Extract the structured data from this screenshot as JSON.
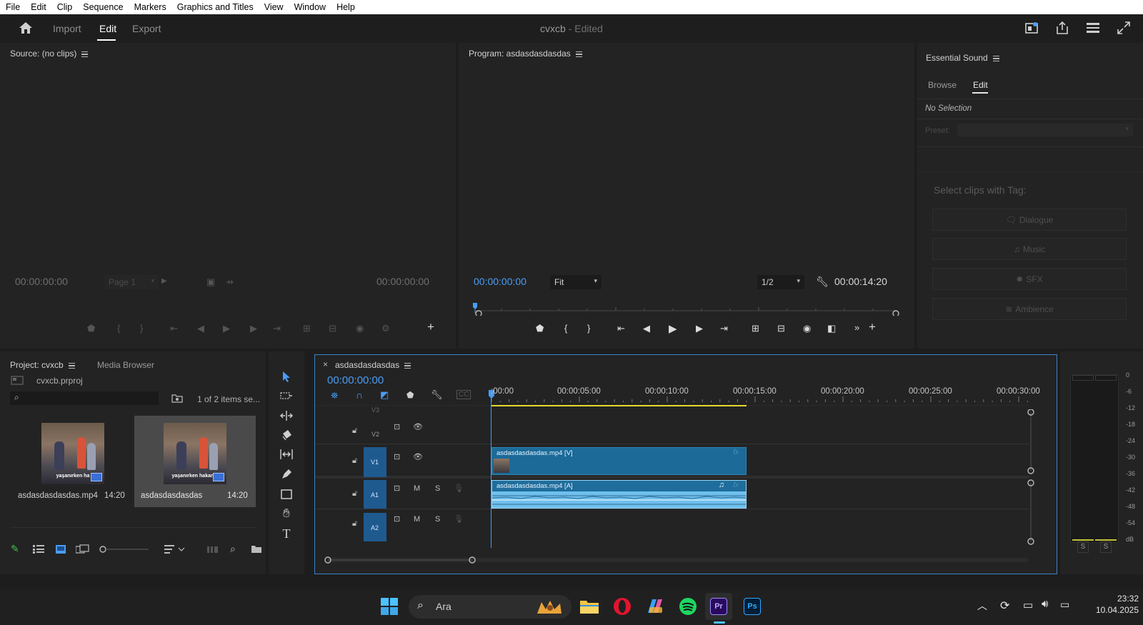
{
  "menu": [
    "File",
    "Edit",
    "Clip",
    "Sequence",
    "Markers",
    "Graphics and Titles",
    "View",
    "Window",
    "Help"
  ],
  "header": {
    "tabs": [
      "Import",
      "Edit",
      "Export"
    ],
    "active_tab": "Edit",
    "project_name": "cvxcb",
    "status": "- Edited",
    "icons": [
      "home-icon",
      "quick-export-icon",
      "share-icon",
      "workspaces-icon",
      "fullscreen-icon"
    ]
  },
  "source_monitor": {
    "title": "Source: (no clips)",
    "timecode_left": "00:00:00:00",
    "page_dropdown": "Page 1",
    "timecode_right": "00:00:00:00"
  },
  "program_monitor": {
    "title": "Program: asdasdasdasdas",
    "timecode": "00:00:00:00",
    "zoom": "Fit",
    "resolution": "1/2",
    "duration": "00:00:14:20"
  },
  "essential_sound": {
    "title": "Essential Sound",
    "tabs": [
      "Browse",
      "Edit"
    ],
    "active_tab": "Edit",
    "selection": "No Selection",
    "preset_label": "Preset:",
    "tag_heading": "Select clips with Tag:",
    "tags": [
      "Dialogue",
      "Music",
      "SFX",
      "Ambience"
    ]
  },
  "project": {
    "title": "Project: cvxcb",
    "tabs": [
      "Media Browser"
    ],
    "file": "cvxcb.prproj",
    "search_placeholder": "",
    "items_count": "1 of 2 items se...",
    "items": [
      {
        "name": "asdasdasdasdas.mp4",
        "duration": "14:20",
        "caption": "yaşanırken ha"
      },
      {
        "name": "asdasdasdasdas",
        "duration": "14:20",
        "caption": "yaşanırken hakan fı"
      }
    ]
  },
  "timeline": {
    "sequence_name": "asdasdasdasdas",
    "timecode": "00:00:00:00",
    "ruler": [
      ":00:00",
      "00:00:05:00",
      "00:00:10:00",
      "00:00:15:00",
      "00:00:20:00",
      "00:00:25:00",
      "00:00:30:00"
    ],
    "tracks": [
      {
        "id": "V3"
      },
      {
        "id": "V2"
      },
      {
        "id": "V1"
      },
      {
        "id": "A1"
      },
      {
        "id": "A2"
      }
    ],
    "track_buttons": {
      "mute": "M",
      "solo": "S"
    },
    "clips": [
      {
        "label": "asdasdasdasdas.mp4 [V]",
        "track": "V1",
        "start_sec": 0,
        "end_sec": 14.8
      },
      {
        "label": "asdasdasdasdas.mp4 [A]",
        "track": "A1",
        "start_sec": 0,
        "end_sec": 14.8
      }
    ],
    "fx_label": "fx"
  },
  "audio_meter": {
    "scale": [
      "0",
      "-6",
      "-12",
      "-18",
      "-24",
      "-30",
      "-36",
      "-42",
      "-48",
      "-54",
      "dB"
    ],
    "solo_buttons": [
      "S",
      "S"
    ]
  },
  "taskbar": {
    "search_placeholder": "Ara",
    "apps": [
      "start-icon",
      "search-icon",
      "file-explorer-icon",
      "opera-icon",
      "copilot-icon",
      "spotify-icon",
      "premiere-pro-icon",
      "photoshop-icon"
    ],
    "premiere_label": "Pr",
    "photoshop_label": "Ps",
    "time": "23:32",
    "date": "10.04.2025"
  }
}
